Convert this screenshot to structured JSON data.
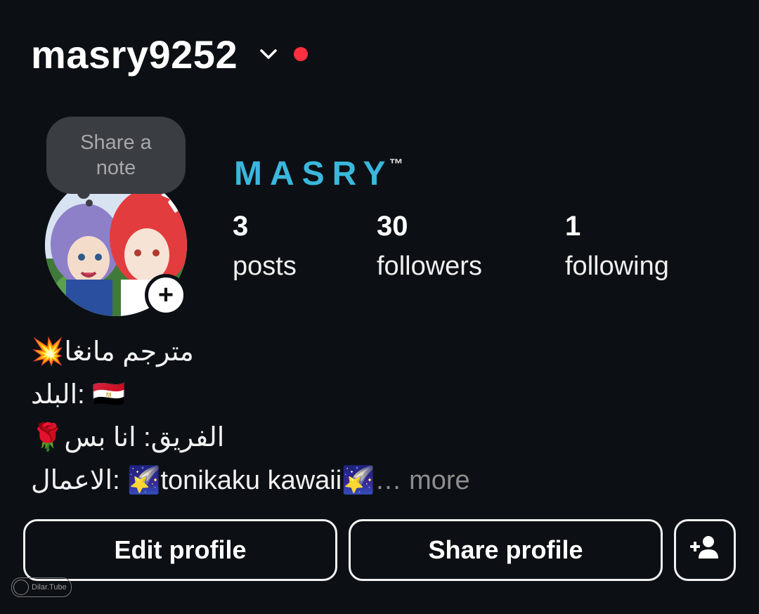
{
  "header": {
    "username": "masry9252",
    "colors": {
      "notification_dot": "#ff3040"
    }
  },
  "note": {
    "line1": "Share a",
    "line2": "note"
  },
  "profile": {
    "display_name": "MASRY",
    "trademark": "™",
    "name_color": "#3ab7dc"
  },
  "stats": {
    "posts": {
      "count": "3",
      "label": "posts"
    },
    "followers": {
      "count": "30",
      "label": "followers"
    },
    "following": {
      "count": "1",
      "label": "following"
    }
  },
  "bio": {
    "line1": "💥مترجم مانغا",
    "line2": "البلد: 🇪🇬",
    "line3": "🌹الفريق:  انا بس",
    "line4": "الاعمال: 🌠tonikaku kawaii🌠",
    "ellipsis": "…",
    "more": "more"
  },
  "buttons": {
    "edit_profile": "Edit profile",
    "share_profile": "Share profile"
  },
  "watermark": {
    "text": "Dilar.Tube"
  },
  "icons": {
    "chevron": "chevron-down-icon",
    "add_story": "plus-icon",
    "discover_people": "add-person-icon"
  }
}
